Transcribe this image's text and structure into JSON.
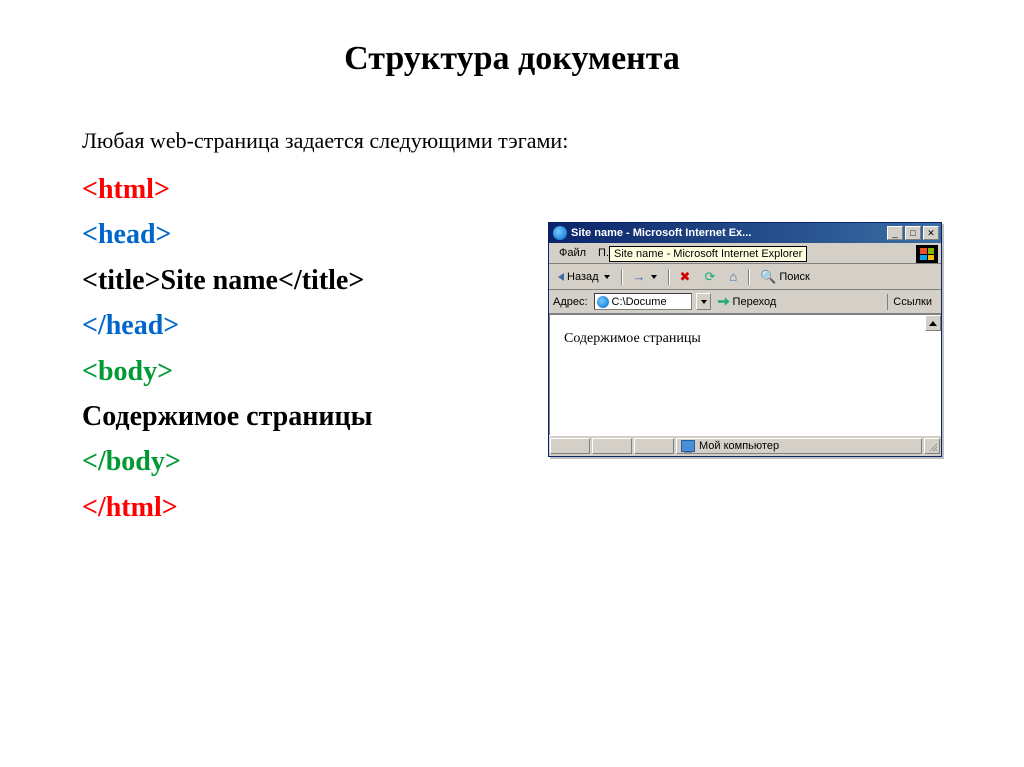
{
  "slide": {
    "title": "Структура документа",
    "intro": "Любая web-страница задается следующими тэгами:",
    "lines": [
      {
        "text": "<html>",
        "cls": "c-red"
      },
      {
        "text": "<head>",
        "cls": "c-blue"
      },
      {
        "text_pre": "<title>",
        "text_mid": "Site name",
        "text_post": "</title>",
        "cls": "c-black",
        "mixed": true
      },
      {
        "text": "</head>",
        "cls": "c-blue"
      },
      {
        "text": "<body>",
        "cls": "c-green"
      },
      {
        "text": "Содержимое страницы",
        "cls": "c-black"
      },
      {
        "text": "</body>",
        "cls": "c-green"
      },
      {
        "text": "</html>",
        "cls": "c-red"
      }
    ]
  },
  "ie": {
    "title": "Site name - Microsoft Internet Ex...",
    "caption": {
      "min": "_",
      "max": "□",
      "close": "✕"
    },
    "menu": {
      "file": "Файл",
      "truncated": "П..."
    },
    "tooltip": "Site name - Microsoft Internet Explorer",
    "toolbar": {
      "back": "Назад",
      "search": "Поиск"
    },
    "address": {
      "label": "Адрес:",
      "value": "C:\\Docume",
      "go": "Переход",
      "links": "Ссылки"
    },
    "content": "Содержимое страницы",
    "status": {
      "zone": "Мой компьютер"
    }
  }
}
